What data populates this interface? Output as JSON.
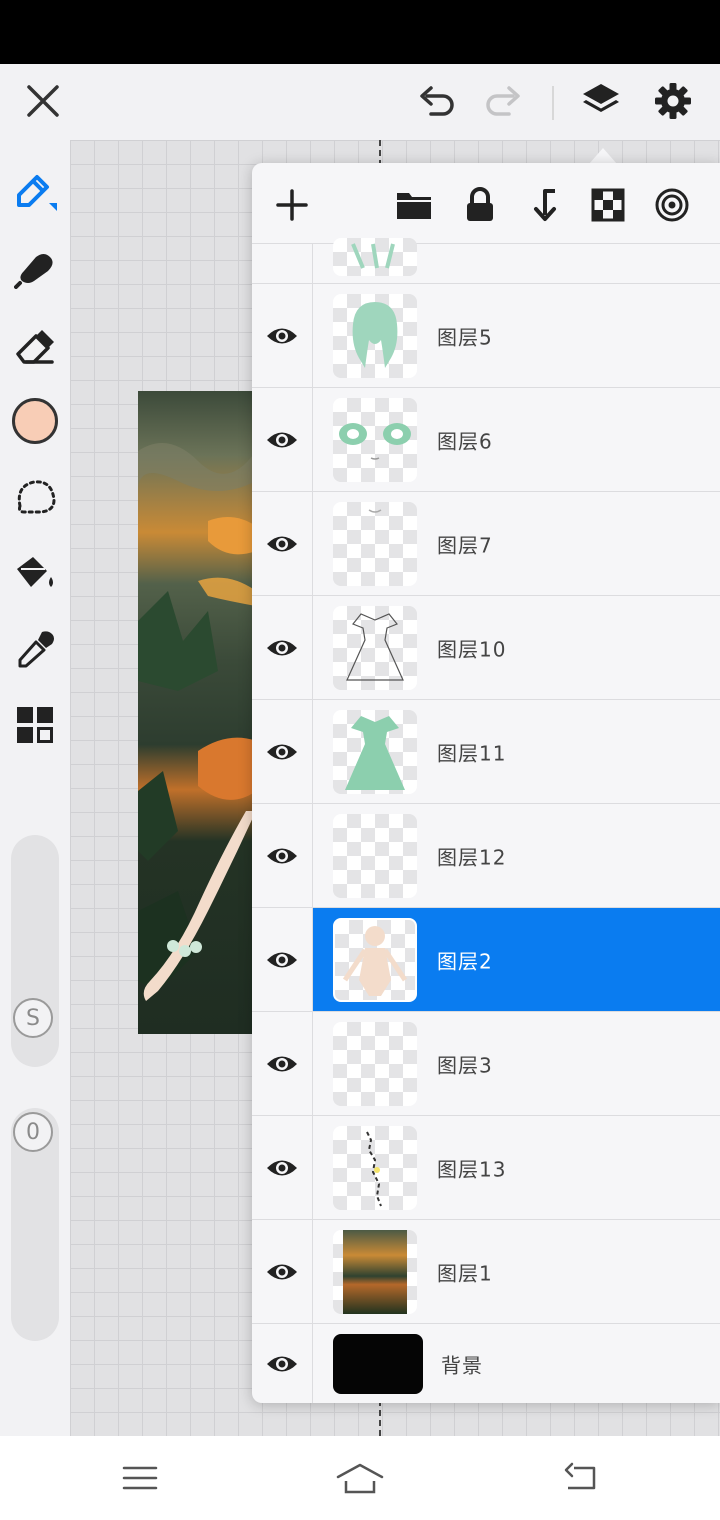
{
  "colors": {
    "accent": "#0a7cf0",
    "brush_color": "#f8cdb6",
    "selected_row": "#0a7cf0",
    "background_thumb": "#050505"
  },
  "toolbar": {
    "close_icon": "close-icon",
    "undo_icon": "undo-icon",
    "redo_icon": "redo-icon",
    "layers_icon": "layers-icon",
    "settings_icon": "gear-icon"
  },
  "tools": [
    "pen-icon",
    "smudge-icon",
    "eraser-icon",
    "color-swatch",
    "lasso-icon",
    "fill-bucket-icon",
    "eyedropper-icon",
    "grid-icon"
  ],
  "sliders": {
    "size_knob": "S",
    "opacity_knob": "0"
  },
  "layer_panel": {
    "actions": [
      "add-layer-icon",
      "folder-icon",
      "lock-icon",
      "merge-down-icon",
      "transparency-icon",
      "target-icon"
    ],
    "layers": [
      {
        "name": "图层5",
        "visible": true,
        "selected": false
      },
      {
        "name": "图层6",
        "visible": true,
        "selected": false
      },
      {
        "name": "图层7",
        "visible": true,
        "selected": false
      },
      {
        "name": "图层10",
        "visible": true,
        "selected": false
      },
      {
        "name": "图层11",
        "visible": true,
        "selected": false
      },
      {
        "name": "图层12",
        "visible": true,
        "selected": false
      },
      {
        "name": "图层2",
        "visible": true,
        "selected": true
      },
      {
        "name": "图层3",
        "visible": true,
        "selected": false
      },
      {
        "name": "图层13",
        "visible": true,
        "selected": false
      },
      {
        "name": "图层1",
        "visible": true,
        "selected": false
      }
    ],
    "background_layer": {
      "name": "背景",
      "visible": true
    }
  },
  "nav": [
    "menu-icon",
    "home-icon",
    "back-icon"
  ]
}
